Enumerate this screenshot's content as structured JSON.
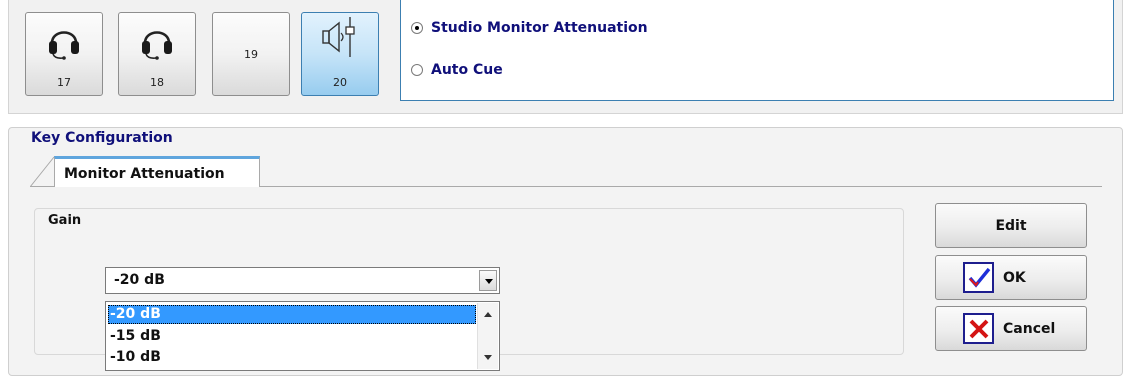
{
  "keys": [
    {
      "number": "17",
      "icon": "headset-icon",
      "active": false
    },
    {
      "number": "18",
      "icon": "headset-icon",
      "active": false
    },
    {
      "number": "19",
      "icon": "",
      "active": false
    },
    {
      "number": "20",
      "icon": "speaker-fader-icon",
      "active": true
    }
  ],
  "mode": {
    "options": [
      {
        "label": "Studio Monitor Attenuation",
        "checked": true
      },
      {
        "label": "Auto Cue",
        "checked": false
      }
    ]
  },
  "config": {
    "title": "Key Configuration",
    "tab_label": "Monitor Attenuation",
    "gain_label": "Gain",
    "gain_value": "-20 dB",
    "gain_options": [
      "-20 dB",
      "-15 dB",
      "-10 dB"
    ],
    "selected_option": "-20 dB"
  },
  "buttons": {
    "edit": "Edit",
    "ok": "OK",
    "cancel": "Cancel"
  },
  "colors": {
    "accent": "#3c7fb1",
    "heading_text": "#10107a",
    "selection": "#3399ff",
    "ok_check": "#1d2fd9",
    "cancel_x": "#d41414"
  }
}
